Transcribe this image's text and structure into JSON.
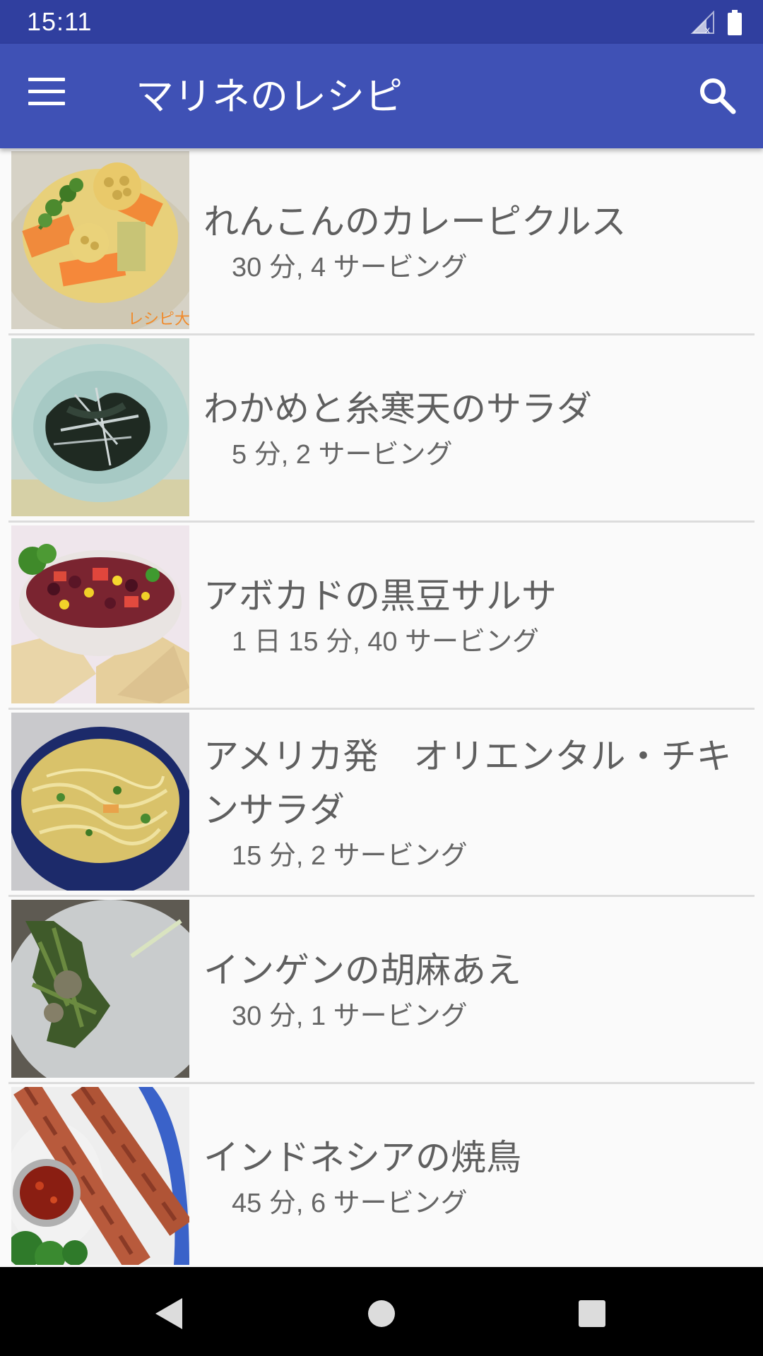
{
  "status_bar": {
    "time": "15:11"
  },
  "app_bar": {
    "title": "マリネのレシピ",
    "menu_icon": "menu-icon",
    "search_icon": "search-icon",
    "color": "#3f51b5",
    "status_color": "#303f9f"
  },
  "recipes": [
    {
      "title": "れんこんのカレーピクルス",
      "meta": "30 分, 4 サービング",
      "thumbnail": "lotus-pickles-photo",
      "watermark": "レシピ大"
    },
    {
      "title": "わかめと糸寒天のサラダ",
      "meta": "5 分, 2 サービング",
      "thumbnail": "wakame-salad-photo"
    },
    {
      "title": "アボカドの黒豆サルサ",
      "meta": "1 日 15 分, 40 サービング",
      "thumbnail": "bean-salsa-photo"
    },
    {
      "title": "アメリカ発　オリエンタル・チキンサラダ",
      "meta": "15 分, 2 サービング",
      "thumbnail": "noodle-salad-photo"
    },
    {
      "title": "インゲンの胡麻あえ",
      "meta": "30 分, 1 サービング",
      "thumbnail": "green-beans-photo"
    },
    {
      "title": "インドネシアの焼鳥",
      "meta": "45 分, 6 サービング",
      "thumbnail": "chicken-skewers-photo"
    }
  ],
  "nav_bar": {
    "back_icon": "back-icon",
    "home_icon": "home-icon",
    "recents_icon": "recents-icon"
  }
}
